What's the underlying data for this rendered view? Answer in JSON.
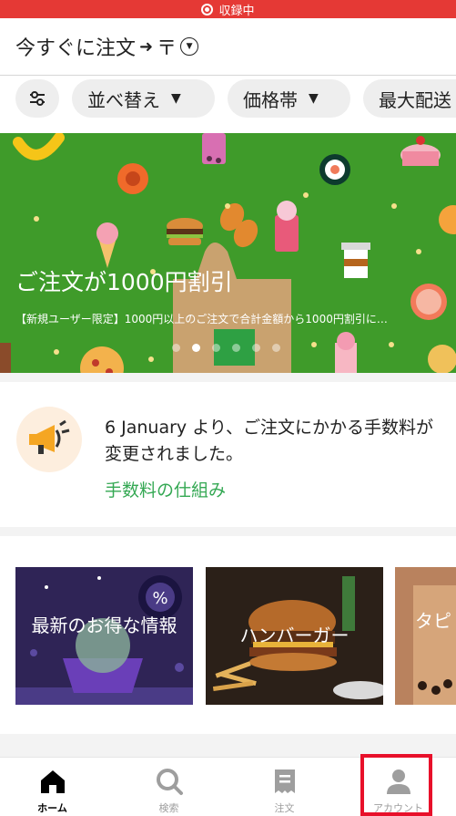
{
  "status_bar": {
    "recording_label": "収録中"
  },
  "header": {
    "delivery_time": "今すぐに注文",
    "arrow": "➜",
    "location": "〒"
  },
  "filters": {
    "sort_label": "並べ替え",
    "price_label": "価格帯",
    "max_fee_label": "最大配送"
  },
  "banner": {
    "title": "ご注文が1000円割引",
    "subtitle": "【新規ユーザー限定】1000円以上のご注文で合計金額から1000円割引に…",
    "page_count": 6,
    "active_page": 1
  },
  "notice": {
    "text": "6 January より、ご注文にかかる手数料が変更されました。",
    "link": "手数料の仕組み"
  },
  "categories": [
    {
      "label": "最新のお得な情報"
    },
    {
      "label": "ハンバーガー"
    },
    {
      "label": "タピ"
    }
  ],
  "tabbar": {
    "home": "ホーム",
    "search": "検索",
    "orders": "注文",
    "account": "アカウント",
    "active": "home"
  },
  "colors": {
    "brand_green": "#3f9b2a",
    "link_green": "#34a853",
    "record_red": "#e53935",
    "highlight_red": "#e8102a"
  }
}
